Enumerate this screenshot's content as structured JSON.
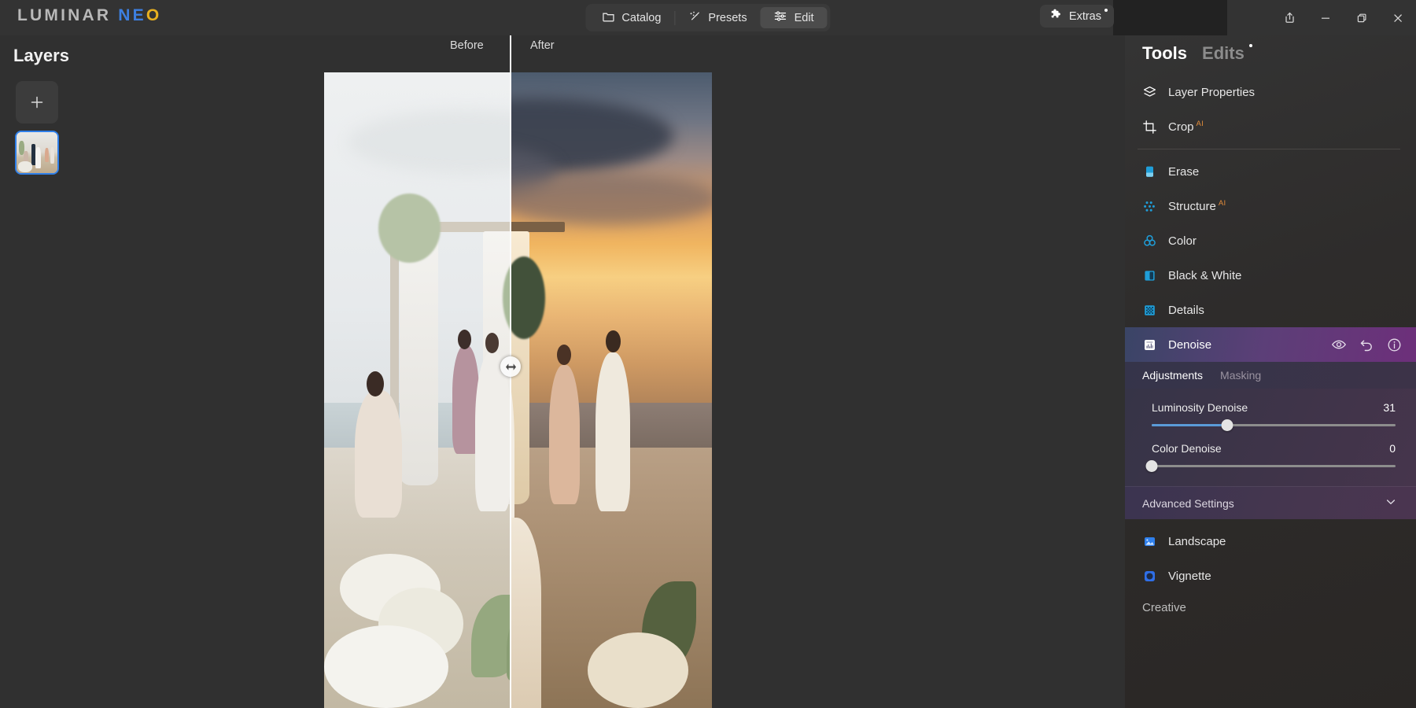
{
  "app": {
    "logo_part1": "LUMINAR",
    "logo_part2_blue": "NE",
    "logo_part2_yellow": "O"
  },
  "titlebar": {
    "nav": [
      {
        "label": "Catalog",
        "icon": "folder-icon",
        "active": false
      },
      {
        "label": "Presets",
        "icon": "magic-wand-icon",
        "active": false
      },
      {
        "label": "Edit",
        "icon": "sliders-icon",
        "active": true
      }
    ],
    "extras": {
      "label": "Extras",
      "icon": "puzzle-icon",
      "badge": true
    },
    "window_controls": [
      {
        "name": "share-button",
        "glyph": "share-icon"
      },
      {
        "name": "minimize-button",
        "glyph": "minimize-icon"
      },
      {
        "name": "maximize-button",
        "glyph": "maximize-icon"
      },
      {
        "name": "close-button",
        "glyph": "close-icon"
      }
    ]
  },
  "layers": {
    "title": "Layers",
    "add_button_label": "+",
    "items": [
      {
        "name": "wedding-photo-layer",
        "selected": true
      }
    ]
  },
  "canvas": {
    "before_label": "Before",
    "after_label": "After",
    "compare_handle": "before-after-slider-handle"
  },
  "tools": {
    "tabs": [
      {
        "label": "Tools",
        "active": true,
        "badge": false
      },
      {
        "label": "Edits",
        "active": false,
        "badge": true
      }
    ],
    "items": [
      {
        "label": "Layer Properties",
        "icon": "layers-icon",
        "ai": false,
        "color": "#ffffff",
        "active": false
      },
      {
        "label": "Crop",
        "icon": "crop-icon",
        "ai": true,
        "color": "#ffffff",
        "active": false
      },
      {
        "label": "Erase",
        "icon": "eraser-icon",
        "ai": false,
        "color": "#1f9ed9",
        "active": false
      },
      {
        "label": "Structure",
        "icon": "structure-dots-icon",
        "ai": true,
        "color": "#1f9ed9",
        "active": false
      },
      {
        "label": "Color",
        "icon": "color-wheel-icon",
        "ai": false,
        "color": "#1f9ed9",
        "active": false
      },
      {
        "label": "Black & White",
        "icon": "black-white-icon",
        "ai": false,
        "color": "#1f9ed9",
        "active": false
      },
      {
        "label": "Details",
        "icon": "details-grid-icon",
        "ai": false,
        "color": "#1f9ed9",
        "active": false
      },
      {
        "label": "Denoise",
        "icon": "denoise-icon",
        "ai": false,
        "color": "#ffffff",
        "active": true
      }
    ],
    "ai_badge_text": "AI",
    "denoise_row_actions": [
      {
        "name": "visibility-toggle-icon",
        "glyph": "eye-icon"
      },
      {
        "name": "reset-icon",
        "glyph": "undo-arrow-icon"
      },
      {
        "name": "info-icon",
        "glyph": "info-circle-icon"
      }
    ],
    "denoise_panel": {
      "subtabs": [
        {
          "label": "Adjustments",
          "active": true
        },
        {
          "label": "Masking",
          "active": false
        }
      ],
      "sliders": [
        {
          "label": "Luminosity Denoise",
          "value": 31,
          "min": 0,
          "max": 100,
          "percent": 31
        },
        {
          "label": "Color Denoise",
          "value": 0,
          "min": 0,
          "max": 100,
          "percent": 0
        }
      ],
      "advanced_settings_label": "Advanced Settings",
      "advanced_settings_expanded": false
    },
    "bottom_items": [
      {
        "label": "Landscape",
        "icon": "landscape-image-icon",
        "color": "#2f80ed"
      },
      {
        "label": "Vignette",
        "icon": "vignette-icon",
        "color": "#2f6fe8"
      }
    ],
    "section_label_partial": "Creative"
  },
  "colors": {
    "accent_blue": "#1f9ed9",
    "slider_fill": "#5a9bd8",
    "active_gradient_start": "#3a4566",
    "active_gradient_end": "#6d2f7a",
    "ai_badge": "#e08b3a",
    "panel_bg": "#303030",
    "titlebar_bg": "#333333"
  }
}
